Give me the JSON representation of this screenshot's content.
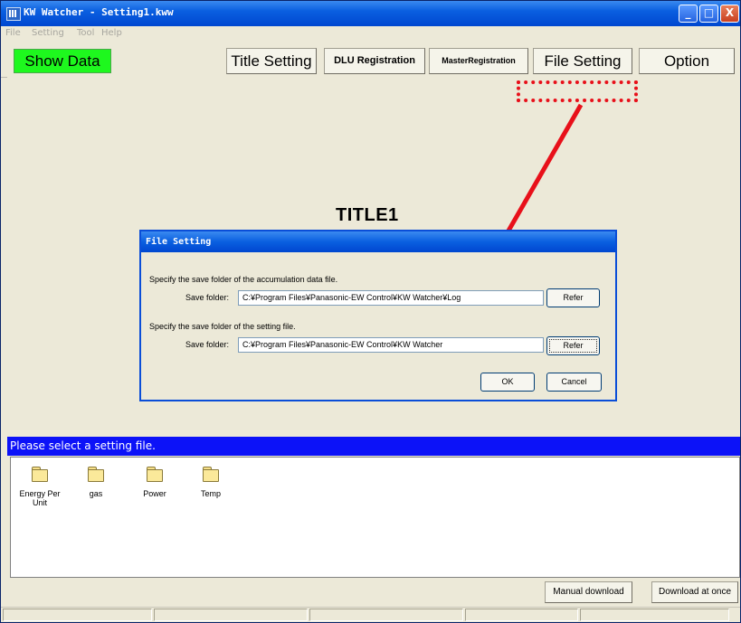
{
  "window": {
    "title": "KW Watcher - Setting1.kww",
    "controls": {
      "minimize": "_",
      "maximize": "□",
      "close": "X"
    }
  },
  "menu": [
    "File",
    "Setting",
    "Tool",
    "Help"
  ],
  "toolbar": {
    "show_data": "Show Data",
    "title_setting": "Title Setting",
    "dlu_registration": "DLU Registration",
    "master_registration": "MasterRegistration",
    "file_setting": "File Setting",
    "option": "Option"
  },
  "main": {
    "page_title": "TITLE1"
  },
  "dialog": {
    "title": "File Setting",
    "accumulation": {
      "instruction": "Specify the save folder of the accumulation data file.",
      "label": "Save folder:",
      "value": "C:¥Program Files¥Panasonic-EW Control¥KW Watcher¥Log",
      "refer": "Refer"
    },
    "setting": {
      "instruction": "Specify the save folder of the setting file.",
      "label": "Save folder:",
      "value": "C:¥Program Files¥Panasonic-EW Control¥KW Watcher",
      "refer": "Refer"
    },
    "ok": "OK",
    "cancel": "Cancel"
  },
  "status": "Please select a setting file.",
  "files": [
    {
      "name": "Energy Per Unit",
      "icon": "folder-icon"
    },
    {
      "name": "gas",
      "icon": "folder-icon"
    },
    {
      "name": "Power",
      "icon": "folder-icon"
    },
    {
      "name": "Temp",
      "icon": "folder-icon"
    }
  ],
  "footer": {
    "manual_download": "Manual download",
    "download_at_once": "Download at once"
  },
  "colors": {
    "title_bar": "#0a5fe0",
    "show_data_bg": "#1ef81e",
    "status_bar_bg": "#0c12f8",
    "highlight_marker": "#e8101a"
  }
}
